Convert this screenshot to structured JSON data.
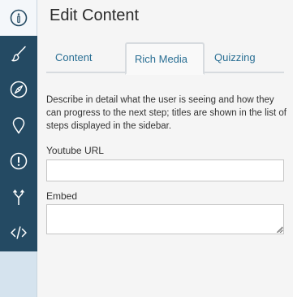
{
  "sidebar": {
    "items": [
      {
        "icon": "info-icon"
      },
      {
        "icon": "brush-icon"
      },
      {
        "icon": "compass-icon"
      },
      {
        "icon": "marker-icon"
      },
      {
        "icon": "alert-icon"
      },
      {
        "icon": "fork-arrow-icon"
      },
      {
        "icon": "code-icon"
      }
    ],
    "colors": {
      "rail": "#244a63",
      "active": "#f4f7fa",
      "below": "#d5e3ee"
    }
  },
  "main": {
    "title": "Edit Content",
    "tabs": [
      {
        "label": "Content"
      },
      {
        "label": "Rich Media",
        "active": true
      },
      {
        "label": "Quizzing"
      }
    ],
    "description": "Describe in detail what the user is seeing and how they can progress to the next step; titles are shown in the list of steps displayed in the sidebar.",
    "fields": {
      "youtube_label": "Youtube URL",
      "youtube_value": "",
      "embed_label": "Embed",
      "embed_value": ""
    }
  }
}
